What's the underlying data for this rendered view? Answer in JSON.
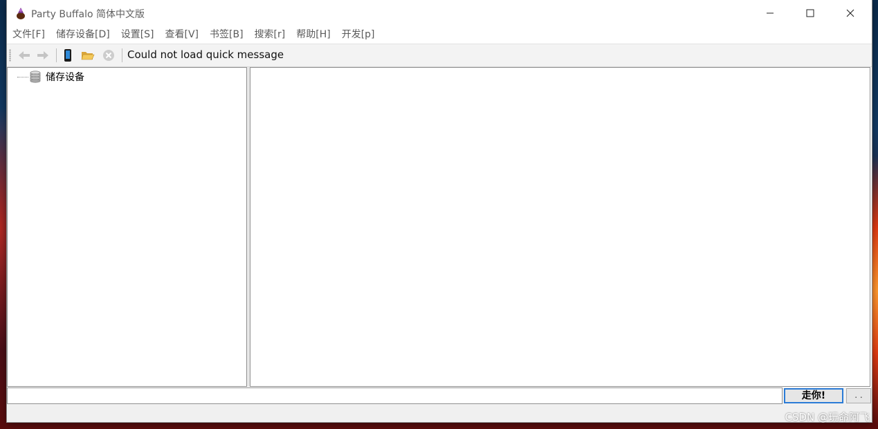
{
  "window": {
    "title": "Party Buffalo 简体中文版",
    "controls": {
      "minimize": "—",
      "maximize": "☐",
      "close": "✕"
    }
  },
  "menu": [
    {
      "label": "文件[F]"
    },
    {
      "label": "储存设备[D]"
    },
    {
      "label": "设置[S]"
    },
    {
      "label": "查看[V]"
    },
    {
      "label": "书签[B]"
    },
    {
      "label": "搜索[r]"
    },
    {
      "label": "帮助[H]"
    },
    {
      "label": "开发[p]"
    }
  ],
  "toolbar": {
    "icons": [
      "back-arrow-icon",
      "forward-arrow-icon",
      "device-icon",
      "open-folder-icon",
      "stop-icon"
    ],
    "message": "Could not load quick message"
  },
  "tree": {
    "root_label": "储存设备",
    "root_icon": "storage-database-icon"
  },
  "command": {
    "input_value": "",
    "go_label": "走你!",
    "more_label": ". ."
  },
  "watermark": "CSDN @玩命阿飞",
  "colors": {
    "accent_border": "#2a7bd6",
    "toolbar_bg": "#f3f3f3",
    "desktop_top": "#0b2a4a",
    "desktop_bottom": "#5a0c0c"
  }
}
